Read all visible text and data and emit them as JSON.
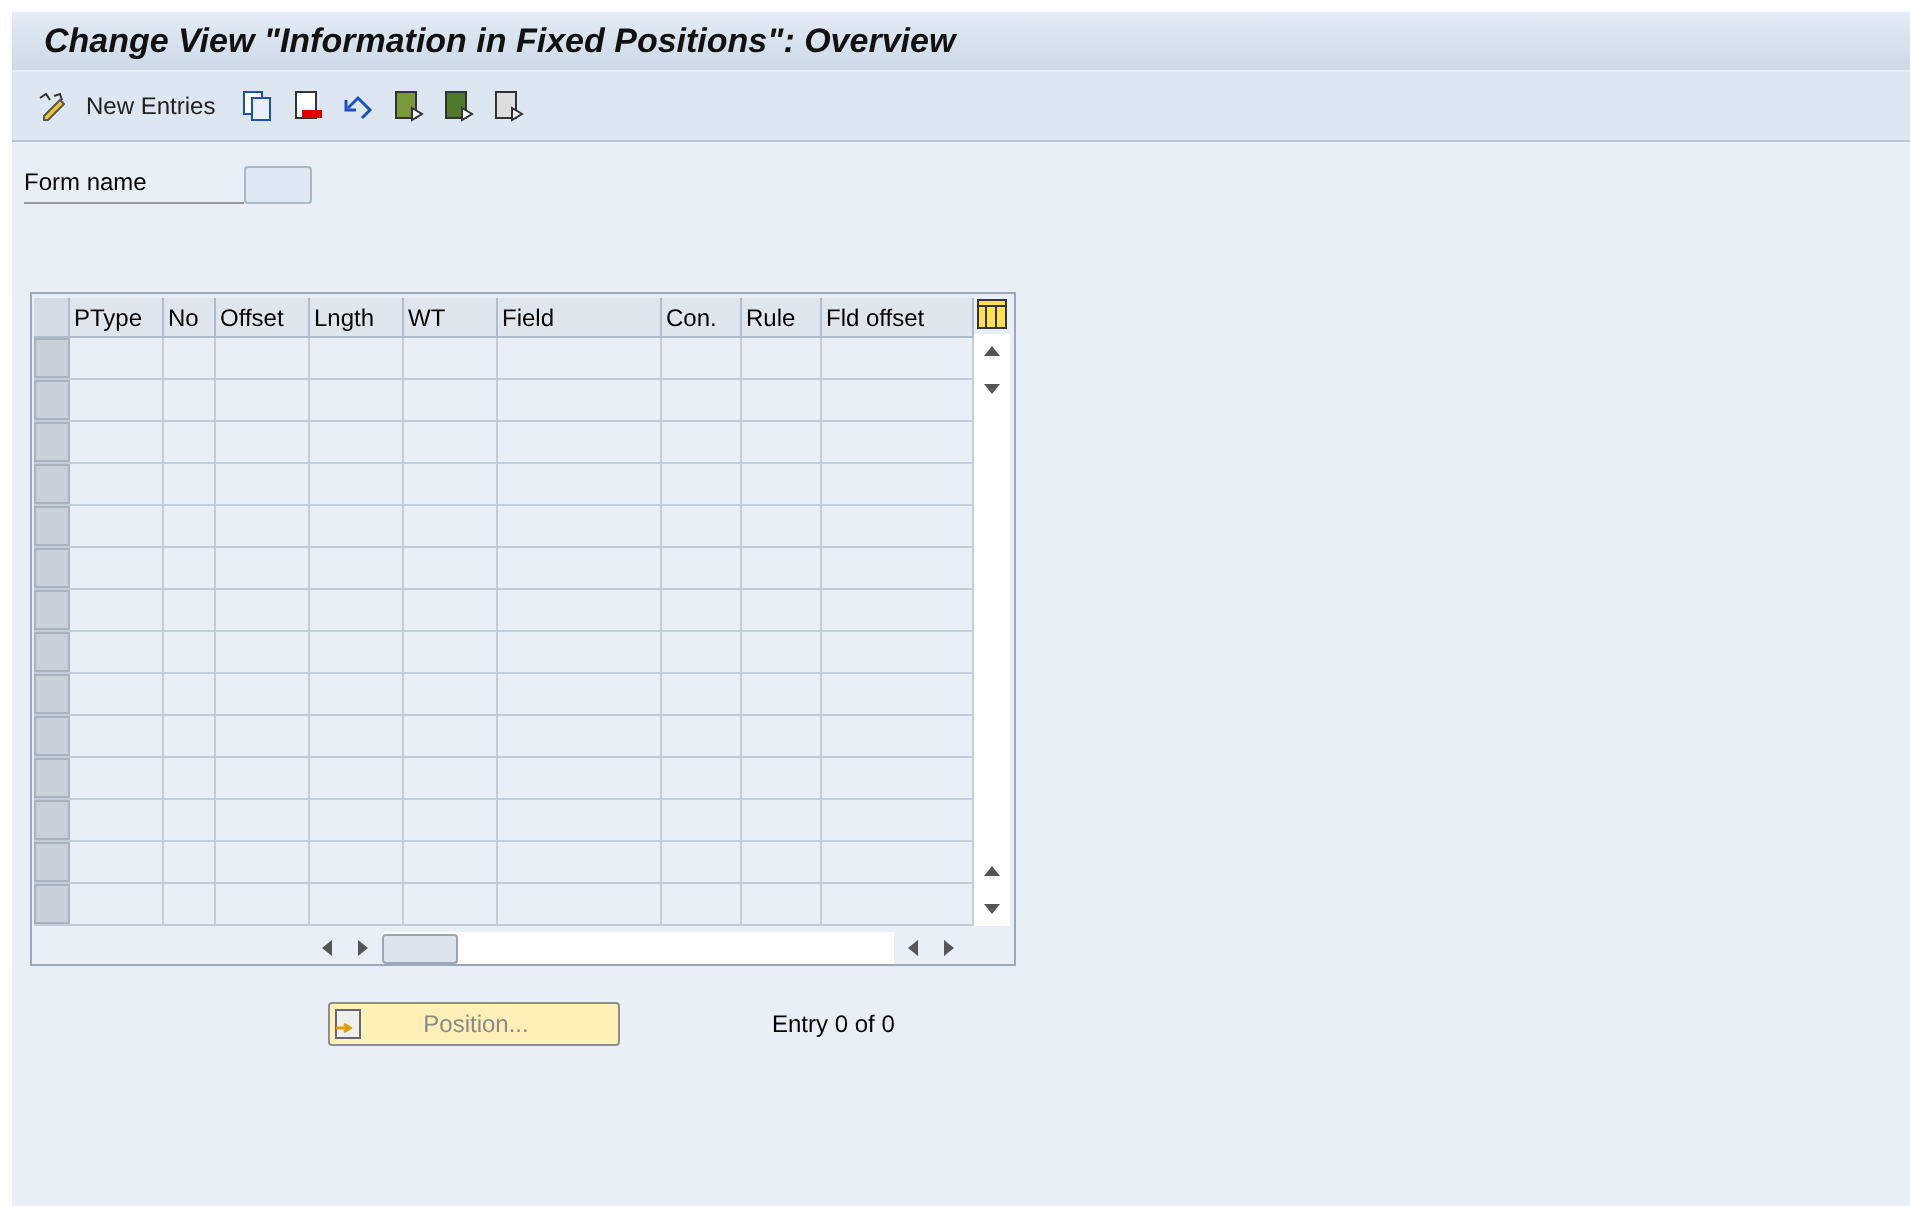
{
  "window": {
    "title": "Change View \"Information in Fixed Positions\": Overview"
  },
  "toolbar": {
    "new_entries": "New Entries"
  },
  "form": {
    "label": "Form name"
  },
  "table": {
    "columns": [
      "PType",
      "No",
      "Offset",
      "Lngth",
      "WT",
      "Field",
      "Con.",
      "Rule",
      "Fld offset"
    ]
  },
  "position_button": {
    "label": "Position...",
    "disabled": true
  },
  "entry_count": "Entry 0 of 0"
}
